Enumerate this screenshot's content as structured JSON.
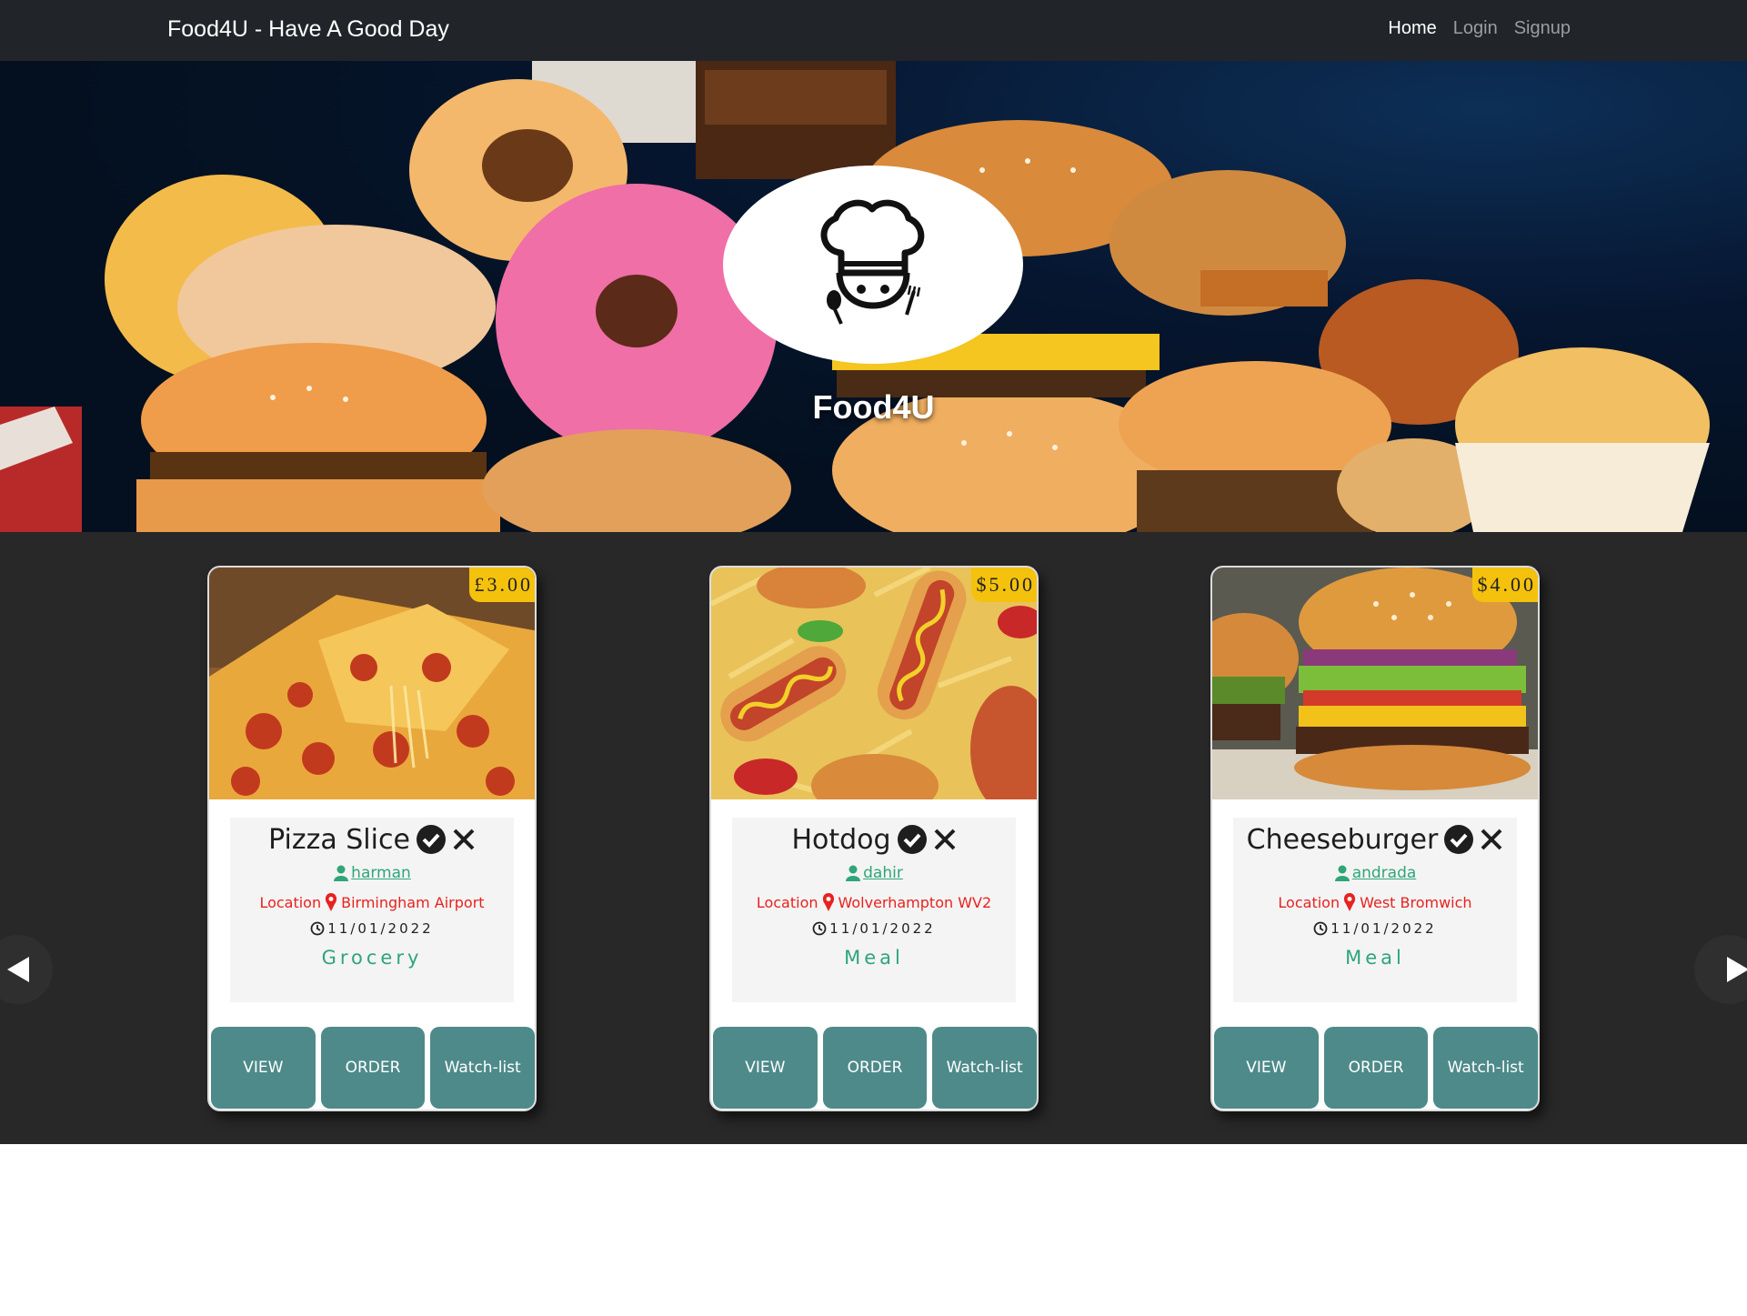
{
  "navbar": {
    "brand": "Food4U - Have A Good Day",
    "links": [
      {
        "label": "Home",
        "active": true
      },
      {
        "label": "Login",
        "active": false
      },
      {
        "label": "Signup",
        "active": false
      }
    ]
  },
  "hero": {
    "title": "Food4U",
    "logo_icon": "chef-icon"
  },
  "carousel": {
    "prev_icon": "arrow-left-icon",
    "next_icon": "arrow-right-icon",
    "cards": [
      {
        "price": "£3.00",
        "title": "Pizza Slice",
        "user": "harman",
        "location_label": "Location",
        "location": "Birmingham Airport",
        "date": "11/01/2022",
        "category": "Grocery",
        "buttons": {
          "view": "VIEW",
          "order": "ORDER",
          "watch": "Watch-list"
        }
      },
      {
        "price": "$5.00",
        "title": "Hotdog",
        "user": "dahir",
        "location_label": "Location",
        "location": "Wolverhampton WV2",
        "date": "11/01/2022",
        "category": "Meal",
        "buttons": {
          "view": "VIEW",
          "order": "ORDER",
          "watch": "Watch-list"
        }
      },
      {
        "price": "$4.00",
        "title": "Cheeseburger",
        "user": "andrada",
        "location_label": "Location",
        "location": "West Bromwich",
        "date": "11/01/2022",
        "category": "Meal",
        "buttons": {
          "view": "VIEW",
          "order": "ORDER",
          "watch": "Watch-list"
        }
      }
    ]
  },
  "colors": {
    "navbar_bg": "#212529",
    "carousel_bg": "#282828",
    "price_badge": "#f4c20d",
    "accent_green": "#2fa57a",
    "location_red": "#e8221e",
    "button_teal": "#4e8a8a"
  }
}
